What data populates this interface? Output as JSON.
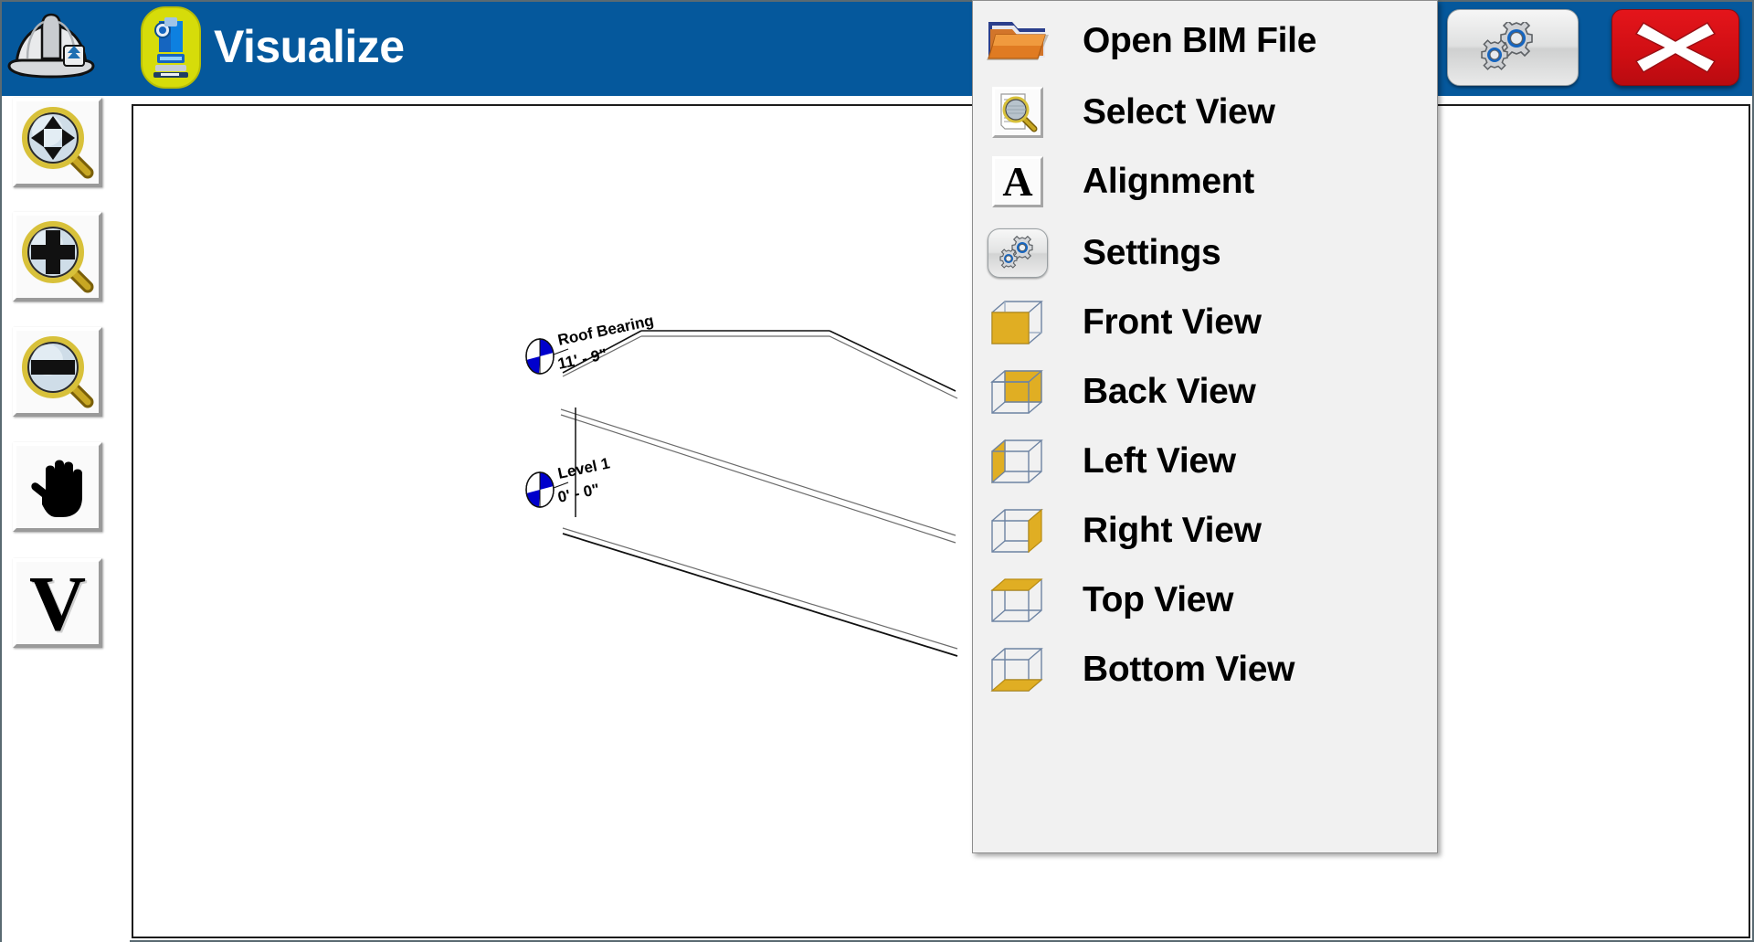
{
  "window": {
    "title": "Visualize",
    "helmet_icon": "hard-hat-icon",
    "app_icon": "total-station-icon",
    "settings_button_icon": "gears-icon",
    "close_button_label": "X"
  },
  "sidebar": {
    "items": [
      {
        "name": "pan-zoom",
        "icon": "magnifier-pan-icon",
        "tooltip": "Pan / Zoom"
      },
      {
        "name": "zoom-in",
        "icon": "magnifier-plus-icon",
        "tooltip": "Zoom In"
      },
      {
        "name": "zoom-out",
        "icon": "magnifier-minus-icon",
        "tooltip": "Zoom Out"
      },
      {
        "name": "pan-hand",
        "icon": "hand-icon",
        "glyph": "✋",
        "tooltip": "Pan"
      },
      {
        "name": "vertical",
        "icon": "letter-v-icon",
        "glyph": "V",
        "tooltip": "V"
      }
    ]
  },
  "menu": {
    "items": [
      {
        "label": "Open BIM File",
        "icon": "open-folder-icon",
        "icon_kind": "folder"
      },
      {
        "label": "Select View",
        "icon": "magnifier-document-icon",
        "icon_kind": "framed-magnifier"
      },
      {
        "label": "Alignment",
        "icon": "letter-a-icon",
        "icon_kind": "framed-letter",
        "glyph": "A"
      },
      {
        "label": "Settings",
        "icon": "gears-icon",
        "icon_kind": "pill-gears"
      },
      {
        "label": "Front View",
        "icon": "cube-front-icon",
        "icon_kind": "cube",
        "face": "front"
      },
      {
        "label": "Back View",
        "icon": "cube-back-icon",
        "icon_kind": "cube",
        "face": "back"
      },
      {
        "label": "Left View",
        "icon": "cube-left-icon",
        "icon_kind": "cube",
        "face": "left"
      },
      {
        "label": "Right View",
        "icon": "cube-right-icon",
        "icon_kind": "cube",
        "face": "right"
      },
      {
        "label": "Top View",
        "icon": "cube-top-icon",
        "icon_kind": "cube",
        "face": "top"
      },
      {
        "label": "Bottom View",
        "icon": "cube-bottom-icon",
        "icon_kind": "cube",
        "face": "bottom"
      }
    ]
  },
  "canvas": {
    "levels": [
      {
        "name": "Roof Bearing",
        "elevation": "11' - 9\""
      },
      {
        "name": "Level 1",
        "elevation": "0' - 0\""
      }
    ]
  },
  "colors": {
    "titlebar_blue": "#05589C",
    "close_red": "#D20E14",
    "menu_bg": "#F1F1F1",
    "cube_gold": "#E0AE23",
    "cube_edge": "#6E84A3",
    "level_marker_blue": "#0000CC",
    "accent_yellow": "#D7DC0B"
  }
}
